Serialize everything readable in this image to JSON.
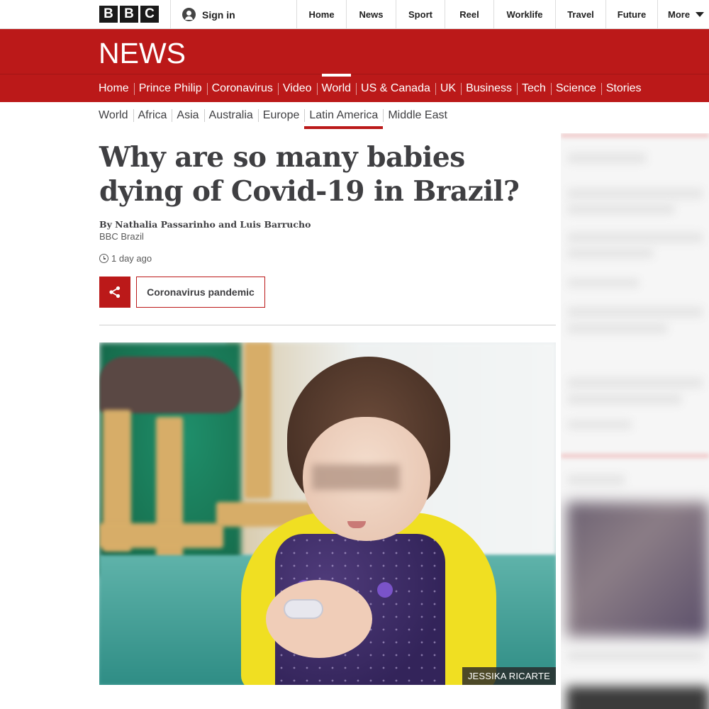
{
  "brand": {
    "letters": [
      "B",
      "B",
      "C"
    ]
  },
  "account": {
    "signin_label": "Sign in",
    "icon": "user-icon"
  },
  "top_nav": {
    "items": [
      {
        "label": "Home"
      },
      {
        "label": "News"
      },
      {
        "label": "Sport"
      },
      {
        "label": "Reel"
      },
      {
        "label": "Worklife"
      },
      {
        "label": "Travel"
      },
      {
        "label": "Future"
      },
      {
        "label": "More"
      }
    ]
  },
  "news_band": {
    "wordmark": "NEWS",
    "color": "#bb1919"
  },
  "main_nav": {
    "active": "World",
    "items": [
      {
        "label": "Home"
      },
      {
        "label": "Prince Philip"
      },
      {
        "label": "Coronavirus"
      },
      {
        "label": "Video"
      },
      {
        "label": "World"
      },
      {
        "label": "US & Canada"
      },
      {
        "label": "UK"
      },
      {
        "label": "Business"
      },
      {
        "label": "Tech"
      },
      {
        "label": "Science"
      },
      {
        "label": "Stories"
      }
    ]
  },
  "sub_nav": {
    "active": "Latin America",
    "items": [
      {
        "label": "World"
      },
      {
        "label": "Africa"
      },
      {
        "label": "Asia"
      },
      {
        "label": "Australia"
      },
      {
        "label": "Europe"
      },
      {
        "label": "Latin America"
      },
      {
        "label": "Middle East"
      }
    ]
  },
  "article": {
    "headline": "Why are so many babies dying of Covid-19 in Brazil?",
    "byline": "By Nathalia Passarinho and Luis Barrucho",
    "byline_org": "BBC Brazil",
    "timestamp": "1 day ago",
    "share_icon": "share-icon",
    "topic_tag": "Coronavirus pandemic",
    "image_credit": "JESSIKA RICARTE"
  }
}
